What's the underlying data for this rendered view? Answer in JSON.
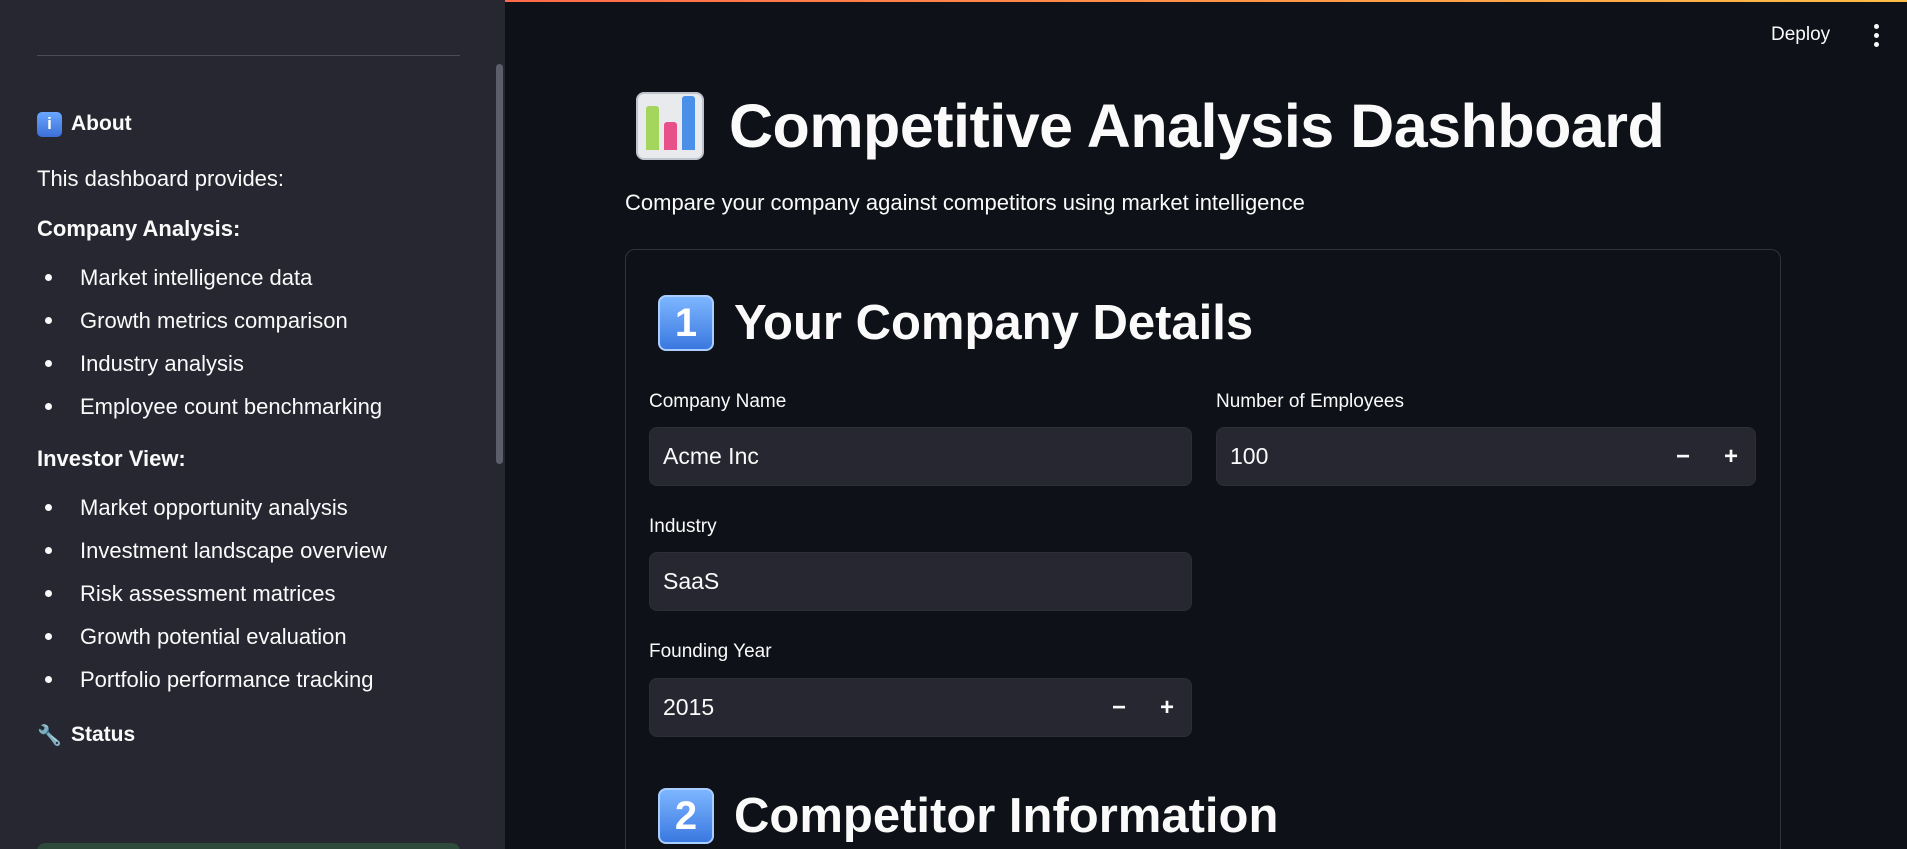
{
  "header": {
    "deploy_label": "Deploy"
  },
  "sidebar": {
    "about_title": "About",
    "about_icon": "info-icon",
    "intro": "This dashboard provides:",
    "company_analysis_title": "Company Analysis:",
    "company_analysis_items": [
      "Market intelligence data",
      "Growth metrics comparison",
      "Industry analysis",
      "Employee count benchmarking"
    ],
    "investor_view_title": "Investor View:",
    "investor_view_items": [
      "Market opportunity analysis",
      "Investment landscape overview",
      "Risk assessment matrices",
      "Growth potential evaluation",
      "Portfolio performance tracking"
    ],
    "status_title": "Status",
    "status_icon": "wrench-icon"
  },
  "main": {
    "title": "Competitive Analysis Dashboard",
    "title_icon": "bar-chart-icon",
    "subtitle": "Compare your company against competitors using market intelligence",
    "section1": {
      "badge": "1",
      "title": "Your Company Details",
      "company_name_label": "Company Name",
      "company_name_value": "Acme Inc",
      "employees_label": "Number of Employees",
      "employees_value": "100",
      "industry_label": "Industry",
      "industry_value": "SaaS",
      "founding_year_label": "Founding Year",
      "founding_year_value": "2015"
    },
    "section2": {
      "badge": "2",
      "title": "Competitor Information"
    }
  },
  "colors": {
    "background": "#0e1117",
    "sidebar": "#262730",
    "input": "#262730",
    "text": "#fafafa"
  }
}
